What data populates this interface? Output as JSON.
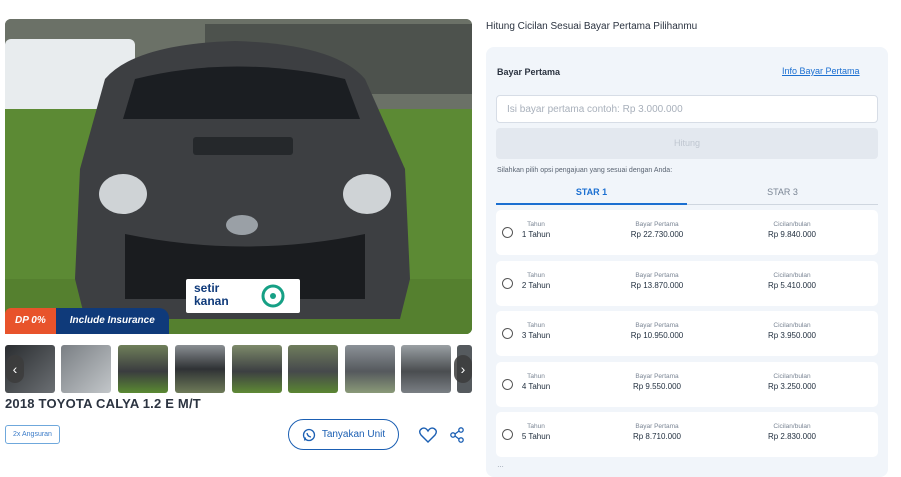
{
  "listing": {
    "title": "2018 TOYOTA CALYA 1.2 E M/T",
    "badge_dp": "DP 0%",
    "badge_insurance": "Include Insurance",
    "angsuran_chip": "2x Angsuran",
    "tanya_button": "Tanyakan Unit",
    "logo_line1": "setir",
    "logo_line2": "kanan",
    "thumbnails": [
      "interior-gauge",
      "engine-bay",
      "front",
      "rear",
      "rear-side",
      "side",
      "side-2",
      "side-3",
      "partial"
    ]
  },
  "calculator": {
    "heading": "Hitung Cicilan Sesuai Bayar Pertama Pilihanmu",
    "bayar_label": "Bayar Pertama",
    "info_link": "Info Bayar Pertama",
    "input_placeholder": "Isi bayar pertama contoh: Rp 3.000.000",
    "hitung_button": "Hitung",
    "hint": "Silahkan pilih opsi pengajuan yang sesuai dengan Anda:",
    "tabs": [
      {
        "label": "STAR 1",
        "active": true
      },
      {
        "label": "STAR 3",
        "active": false
      }
    ],
    "col_tahun": "Tahun",
    "col_bayar": "Bayar Pertama",
    "col_cicilan": "Cicilan/bulan",
    "options": [
      {
        "tahun": "1 Tahun",
        "bayar": "Rp 22.730.000",
        "cicilan": "Rp 9.840.000"
      },
      {
        "tahun": "2 Tahun",
        "bayar": "Rp 13.870.000",
        "cicilan": "Rp 5.410.000"
      },
      {
        "tahun": "3 Tahun",
        "bayar": "Rp 10.950.000",
        "cicilan": "Rp 3.950.000"
      },
      {
        "tahun": "4 Tahun",
        "bayar": "Rp 9.550.000",
        "cicilan": "Rp 3.250.000"
      },
      {
        "tahun": "5 Tahun",
        "bayar": "Rp 8.710.000",
        "cicilan": "Rp 2.830.000"
      }
    ],
    "more_indicator": "…"
  },
  "colors": {
    "brand_blue": "#1b6fd1",
    "navy": "#0f3a7a",
    "dp_orange": "#e8532b",
    "panel_bg": "#f1f5fa"
  }
}
